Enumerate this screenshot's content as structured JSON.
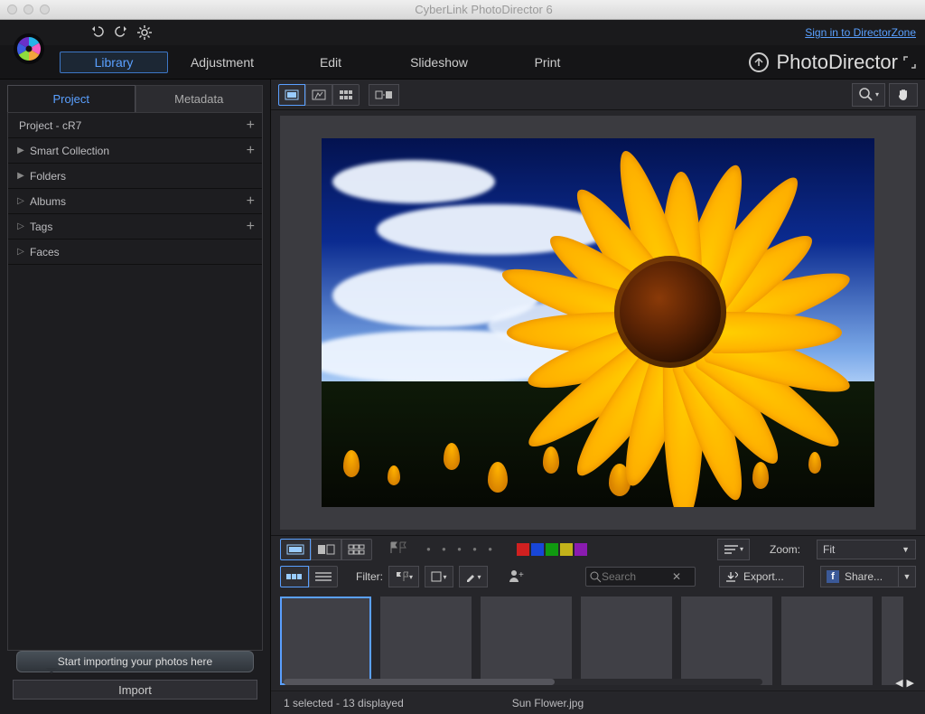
{
  "app_title": "CyberLink PhotoDirector 6",
  "signin_label": "Sign in to DirectorZone",
  "brand": "PhotoDirector",
  "main_tabs": {
    "library": "Library",
    "adjustment": "Adjustment",
    "edit": "Edit",
    "slideshow": "Slideshow",
    "print": "Print"
  },
  "sidebar": {
    "tabs": {
      "project": "Project",
      "metadata": "Metadata"
    },
    "project_root": "Project - cR7",
    "items": [
      {
        "label": "Smart Collection",
        "plus": true,
        "chev": "▶"
      },
      {
        "label": "Folders",
        "plus": false,
        "chev": "▶"
      },
      {
        "label": "Albums",
        "plus": true,
        "chev": "▷"
      },
      {
        "label": "Tags",
        "plus": true,
        "chev": "▷"
      },
      {
        "label": "Faces",
        "plus": false,
        "chev": "▷"
      }
    ],
    "callout": "Start importing your photos here",
    "import_btn": "Import"
  },
  "filmstrip": {
    "colors": [
      "#d02020",
      "#1846d8",
      "#109a10",
      "#c2b21a",
      "#8a1bb0"
    ],
    "zoom_label": "Zoom:",
    "zoom_value": "Fit",
    "filter_label": "Filter:",
    "search_placeholder": "Search",
    "export_label": "Export...",
    "share_label": "Share..."
  },
  "status": {
    "selection": "1 selected - 13 displayed",
    "filename": "Sun Flower.jpg"
  }
}
